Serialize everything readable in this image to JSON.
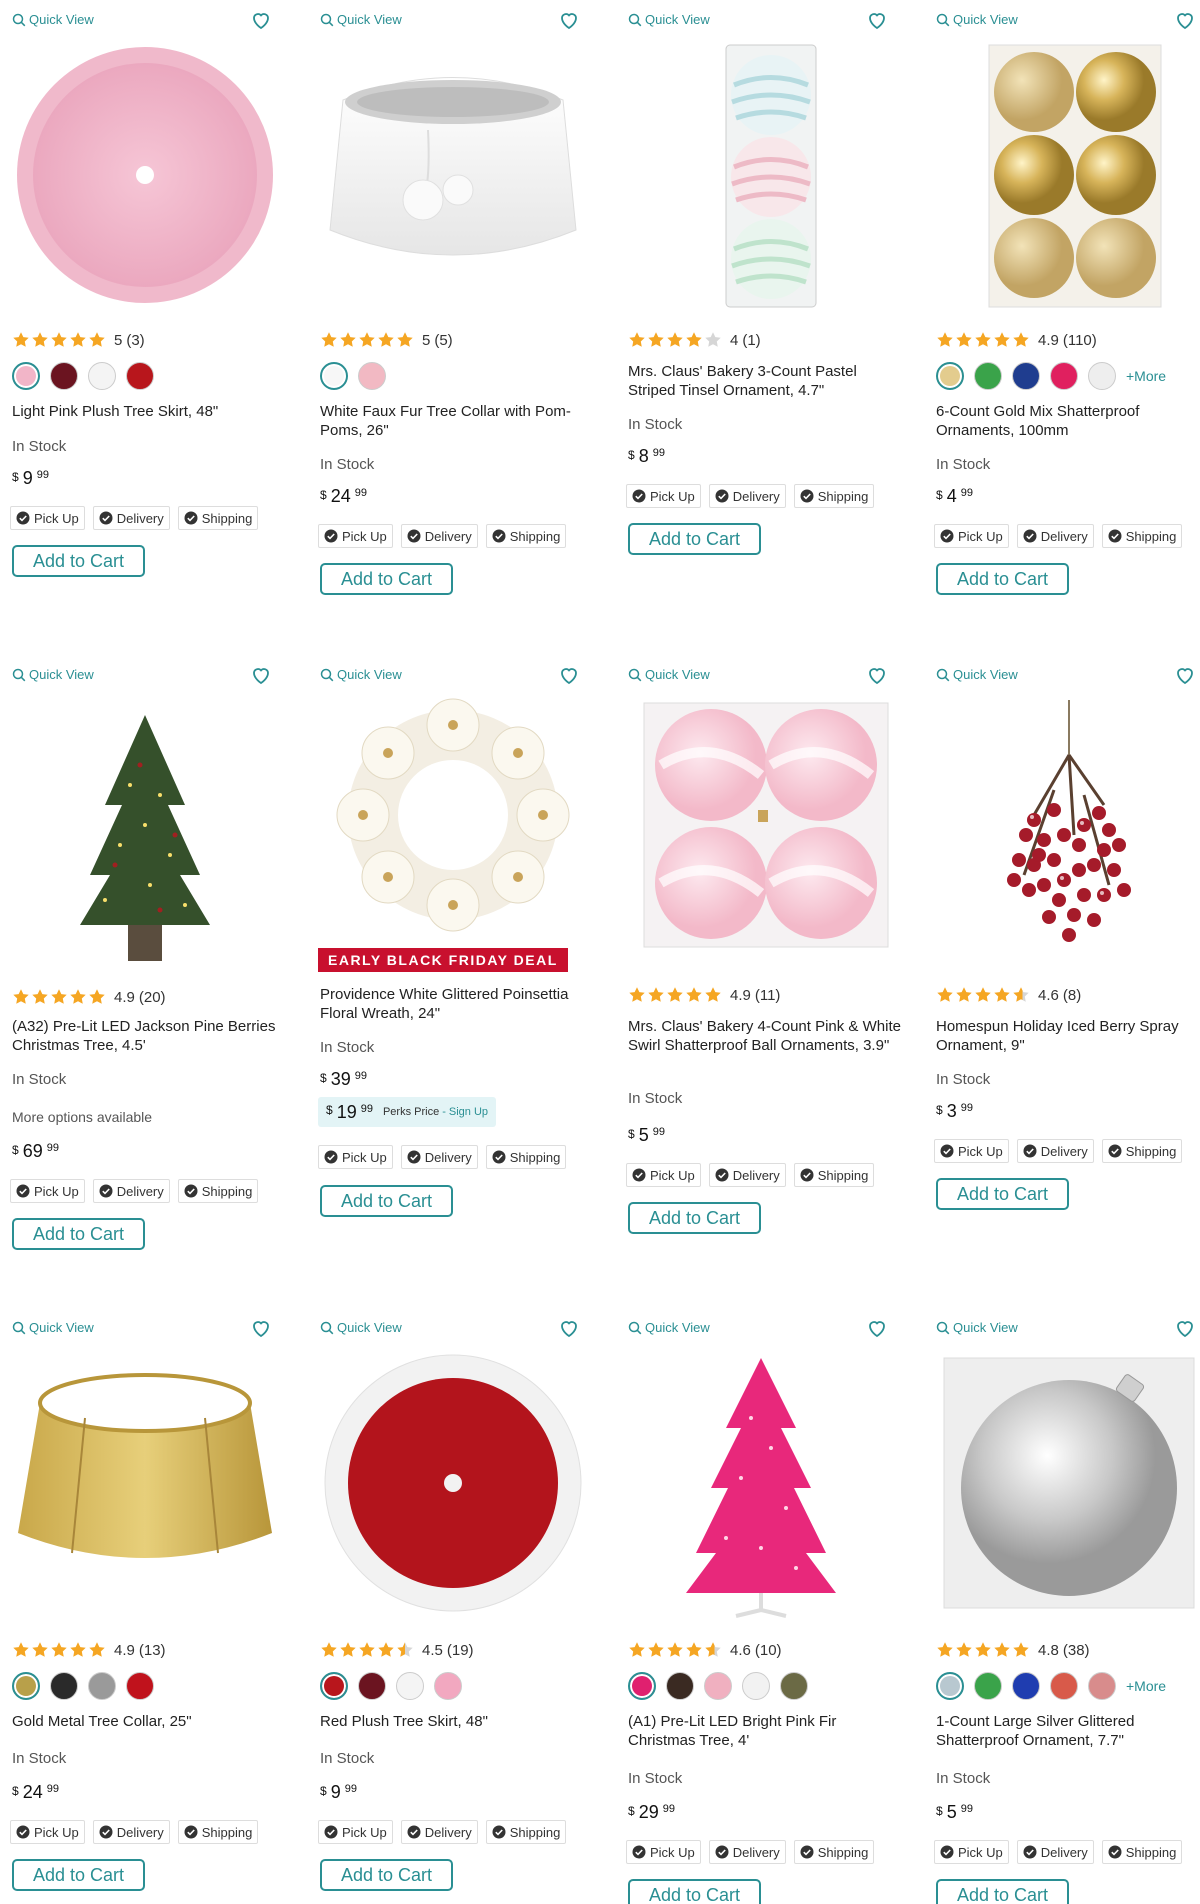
{
  "common": {
    "quick_view": "Quick View",
    "add_to_cart": "Add to Cart",
    "pick_up": "Pick Up",
    "delivery": "Delivery",
    "shipping": "Shipping",
    "in_stock": "In Stock",
    "more_swatches": "+More",
    "currency": "$"
  },
  "colors": {
    "accent": "#2a8f93",
    "star": "#f5a623",
    "deal_red": "#c8102e",
    "perks_bg": "#e3f4f6"
  },
  "products": [
    {
      "image": "pink-tree-skirt",
      "rating": "5",
      "reviews": "(3)",
      "stars": 5,
      "swatches": [
        "#f2b5c8",
        "#6b1420",
        "#f4f4f4",
        "#b8161c"
      ],
      "selected_swatch": 0,
      "show_more": false,
      "title": "Light Pink Plush Tree Skirt, 48\"",
      "price_dollars": "9",
      "price_cents": "99"
    },
    {
      "image": "white-fur-collar",
      "rating": "5",
      "reviews": "(5)",
      "stars": 5,
      "swatches": [
        "#f7f7f7",
        "#f2b9c3"
      ],
      "selected_swatch": 0,
      "show_more": false,
      "title": "White Faux Fur Tree Collar with Pom-Poms, 26\"",
      "price_dollars": "24",
      "price_cents": "99"
    },
    {
      "image": "pastel-ornaments",
      "rating": "4",
      "reviews": "(1)",
      "stars": 4,
      "swatches": [],
      "selected_swatch": -1,
      "show_more": false,
      "title": "Mrs. Claus' Bakery 3-Count Pastel Striped Tinsel Ornament, 4.7\"",
      "price_dollars": "8",
      "price_cents": "99"
    },
    {
      "image": "gold-ornaments",
      "rating": "4.9",
      "reviews": "(110)",
      "stars": 5,
      "swatches": [
        "#e3cc8e",
        "#3aa34a",
        "#1f3d8f",
        "#e0205f",
        "#eeeeee"
      ],
      "selected_swatch": 0,
      "show_more": true,
      "title": "6-Count Gold Mix Shatterproof Ornaments, 100mm",
      "price_dollars": "4",
      "price_cents": "99"
    },
    {
      "image": "pine-tree",
      "rating": "4.9",
      "reviews": "(20)",
      "stars": 5,
      "swatches": [],
      "selected_swatch": -1,
      "show_more": false,
      "title": "(A32) Pre-Lit LED Jackson Pine Berries Christmas Tree, 4.5'",
      "more_options": "More options available",
      "price_dollars": "69",
      "price_cents": "99"
    },
    {
      "image": "poinsettia-wreath",
      "deal": "EARLY BLACK FRIDAY DEAL",
      "rating": "",
      "reviews": "",
      "stars": 0,
      "swatches": [],
      "selected_swatch": -1,
      "show_more": false,
      "title": "Providence White Glittered Poinsettia Floral Wreath, 24\"",
      "price_dollars": "39",
      "price_cents": "99",
      "perks": {
        "dollars": "19",
        "cents": "99",
        "label": "Perks Price",
        "sep": "-",
        "signup": "Sign Up"
      }
    },
    {
      "image": "pink-swirl-ornaments",
      "rating": "4.9",
      "reviews": "(11)",
      "stars": 5,
      "swatches": [],
      "selected_swatch": -1,
      "show_more": false,
      "title": "Mrs. Claus' Bakery 4-Count Pink & White Swirl Shatterproof Ball Ornaments, 3.9\"",
      "price_dollars": "5",
      "price_cents": "99"
    },
    {
      "image": "berry-spray",
      "rating": "4.6",
      "reviews": "(8)",
      "stars": 4.6,
      "swatches": [],
      "selected_swatch": -1,
      "show_more": false,
      "title": "Homespun Holiday Iced Berry Spray Ornament, 9\"",
      "price_dollars": "3",
      "price_cents": "99"
    },
    {
      "image": "gold-collar",
      "rating": "4.9",
      "reviews": "(13)",
      "stars": 5,
      "swatches": [
        "#b8a04a",
        "#2a2a2a",
        "#9a9a9a",
        "#c0121c"
      ],
      "selected_swatch": 0,
      "show_more": false,
      "title": "Gold Metal Tree Collar, 25\"",
      "price_dollars": "24",
      "price_cents": "99"
    },
    {
      "image": "red-tree-skirt",
      "rating": "4.5",
      "reviews": "(19)",
      "stars": 4.5,
      "swatches": [
        "#b8161c",
        "#6b1420",
        "#f4f4f4",
        "#f2a8c0"
      ],
      "selected_swatch": 0,
      "show_more": false,
      "title": "Red Plush Tree Skirt, 48\"",
      "price_dollars": "9",
      "price_cents": "99"
    },
    {
      "image": "pink-fir-tree",
      "rating": "4.6",
      "reviews": "(10)",
      "stars": 4.6,
      "swatches": [
        "#e0206f",
        "#3a2a22",
        "#f0b0c0",
        "#f2f2f2",
        "#6b6a45"
      ],
      "selected_swatch": 0,
      "show_more": false,
      "title": "(A1) Pre-Lit LED Bright Pink Fir Christmas Tree, 4'",
      "price_dollars": "29",
      "price_cents": "99"
    },
    {
      "image": "silver-ornament",
      "rating": "4.8",
      "reviews": "(38)",
      "stars": 5,
      "swatches": [
        "#b8c8d0",
        "#3aa34a",
        "#1f3db0",
        "#d85a4a",
        "#d88c8c"
      ],
      "selected_swatch": 0,
      "show_more": true,
      "title": "1-Count Large Silver Glittered Shatterproof Ornament, 7.7\"",
      "price_dollars": "5",
      "price_cents": "99"
    }
  ]
}
